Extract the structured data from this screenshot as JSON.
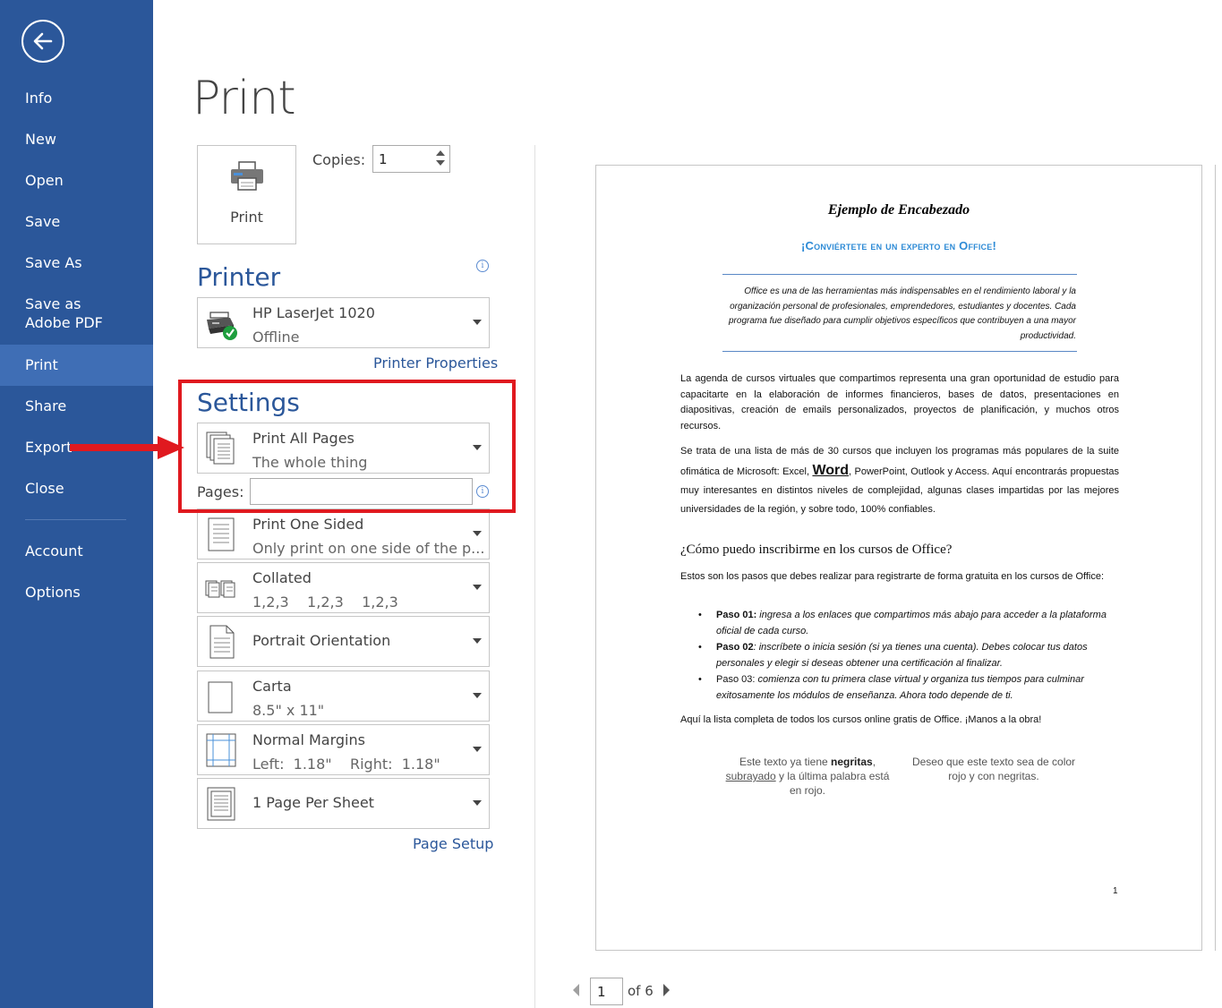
{
  "sidebar": {
    "items": [
      {
        "label": "Info"
      },
      {
        "label": "New"
      },
      {
        "label": "Open"
      },
      {
        "label": "Save"
      },
      {
        "label": "Save As"
      },
      {
        "label": "Save as Adobe PDF"
      },
      {
        "label": "Print"
      },
      {
        "label": "Share"
      },
      {
        "label": "Export"
      },
      {
        "label": "Close"
      },
      {
        "label": "Account"
      },
      {
        "label": "Options"
      }
    ],
    "active": "Print"
  },
  "main": {
    "title": "Print",
    "print_button_label": "Print",
    "copies_label": "Copies:",
    "copies_value": "1"
  },
  "printer": {
    "heading": "Printer",
    "name": "HP LaserJet 1020",
    "status": "Offline",
    "properties_link": "Printer Properties"
  },
  "settings": {
    "heading": "Settings",
    "pages_label": "Pages:",
    "pages_value": "",
    "dropdowns": [
      {
        "title": "Print All Pages",
        "subtitle": "The whole thing"
      },
      {
        "title": "Print One Sided",
        "subtitle": "Only print on one side of the p..."
      },
      {
        "title": "Collated",
        "subtitle": "1,2,3    1,2,3    1,2,3"
      },
      {
        "title": "Portrait Orientation",
        "subtitle": ""
      },
      {
        "title": "Carta",
        "subtitle": "8.5\" x 11\""
      },
      {
        "title": "Normal Margins",
        "subtitle": "Left:  1.18\"    Right:  1.18\""
      },
      {
        "title": "1 Page Per Sheet",
        "subtitle": ""
      }
    ],
    "page_setup_link": "Page Setup"
  },
  "preview": {
    "heading": "Ejemplo de Encabezado",
    "subheading": "¡Conviértete en un experto en Office!",
    "quote": "Office es una de las herramientas más indispensables en el rendimiento laboral y la organización personal de profesionales, emprendedores, estudiantes y docentes. Cada programa fue diseñado para cumplir objetivos específicos que contribuyen a una mayor productividad.",
    "p1": "La agenda de cursos virtuales que compartimos representa una gran oportunidad de estudio para capacitarte en la elaboración de informes financieros, bases de datos, presentaciones en diapositivas, creación de emails personalizados, proyectos de planificación, y muchos otros recursos.",
    "p2_before": "Se trata de una lista de más de 30 cursos que incluyen los programas más populares de la suite ofimática de Microsoft: Excel, ",
    "p2_word": "Word",
    "p2_after": ", PowerPoint, Outlook y Access. Aquí encontrarás propuestas muy interesantes en distintos niveles de complejidad, algunas clases impartidas por las mejores universidades de la región, y sobre todo, 100% confiables.",
    "h3": "¿Cómo puedo inscribirme en los cursos de Office?",
    "p3": "Estos son los pasos que debes realizar para registrarte de forma gratuita en los cursos de Office:",
    "list": [
      {
        "lead": "Paso 01:",
        "text": " ingresa a los enlaces que compartimos más abajo para acceder a la plataforma oficial de cada curso."
      },
      {
        "lead": "Paso 02",
        "text": ": inscríbete o inicia sesión (si ya tienes una cuenta). Debes colocar tus datos personales y elegir si deseas obtener una certificación al finalizar."
      },
      {
        "lead": "Paso 03:",
        "text": " comienza con tu primera clase virtual y organiza tus tiempos para culminar exitosamente los módulos de enseñanza. Ahora todo depende de ti."
      }
    ],
    "p4": "Aquí la lista completa de todos los cursos online gratis de Office. ¡Manos a la obra!",
    "box1_a": "Este texto ya tiene ",
    "box1_b": "negritas",
    "box1_c": ", ",
    "box1_d": "subrayado",
    "box1_e": " y la última palabra está en rojo.",
    "box2": "Deseo que este texto sea de color rojo y con negritas.",
    "page_number": "1"
  },
  "pager": {
    "current": "1",
    "total_label": "of 6"
  },
  "colors": {
    "sidebar": "#2b579a",
    "sidebar_active": "#3f6eb5",
    "accent": "#2b579a",
    "annotation": "#e0191f"
  }
}
